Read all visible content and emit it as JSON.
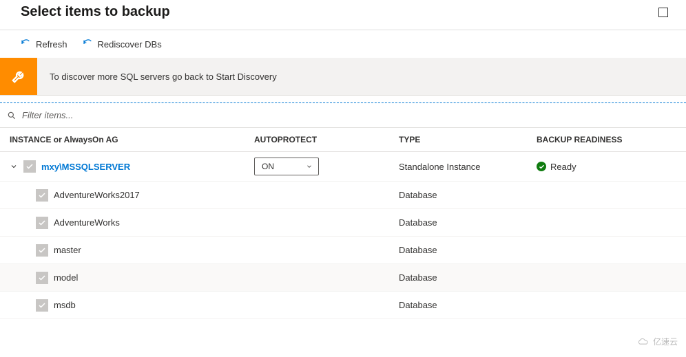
{
  "title": "Select items to backup",
  "toolbar": {
    "refresh_label": "Refresh",
    "rediscover_label": "Rediscover DBs"
  },
  "banner": {
    "message": "To discover more SQL servers go back to Start Discovery"
  },
  "filter": {
    "placeholder": "Filter items..."
  },
  "columns": {
    "instance": "INSTANCE or AlwaysOn AG",
    "autoprotect": "AUTOPROTECT",
    "type": "TYPE",
    "readiness": "BACKUP READINESS"
  },
  "autoprotect_selected": "ON",
  "instance": {
    "name": "mxy\\MSSQLSERVER",
    "type": "Standalone Instance",
    "readiness": "Ready"
  },
  "databases": [
    {
      "name": "AdventureWorks2017",
      "type": "Database",
      "shaded": false
    },
    {
      "name": "AdventureWorks",
      "type": "Database",
      "shaded": false
    },
    {
      "name": "master",
      "type": "Database",
      "shaded": false
    },
    {
      "name": "model",
      "type": "Database",
      "shaded": true
    },
    {
      "name": "msdb",
      "type": "Database",
      "shaded": false
    }
  ],
  "watermark": "亿速云"
}
